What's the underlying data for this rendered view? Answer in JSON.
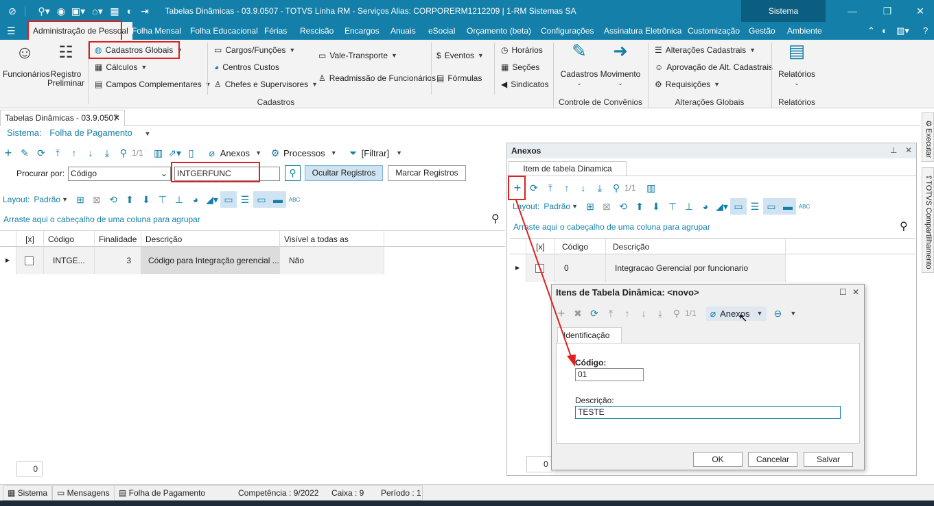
{
  "window": {
    "title": "Tabelas Dinâmicas - 03.9.0507 - TOTVS Linha RM - Serviços  Alias: CORPORERM1212209 | 1-RM Sistemas SA",
    "sistema_tab": "Sistema"
  },
  "menu": [
    "Administração de Pessoal",
    "Folha Mensal",
    "Folha Educacional",
    "Férias",
    "Rescisão",
    "Encargos",
    "Anuais",
    "eSocial",
    "Orçamento (beta)",
    "Configurações",
    "Assinatura Eletrônica",
    "Customização",
    "Gestão",
    "Ambiente"
  ],
  "ribbon": {
    "funcionarios": "Funcionários",
    "registro": "Registro",
    "preliminar": "Preliminar",
    "cadastros_globais": "Cadastros Globais",
    "calculos": "Cálculos",
    "campos_complementares": "Campos Complementares",
    "cargos": "Cargos/Funções",
    "centros": "Centros Custos",
    "chefes": "Chefes e Supervisores",
    "vale": "Vale-Transporte",
    "readmissao": "Readmissão de Funcionários",
    "eventos": "Eventos",
    "formulas": "Fórmulas",
    "horarios": "Horários",
    "secoes": "Seções",
    "sindicatos": "Sindicatos",
    "cadastros_btn": "Cadastros",
    "movimento_btn": "Movimento",
    "alteracoes": "Alterações Cadastrais",
    "aprovacao": "Aprovação de Alt. Cadastrais",
    "requisicoes": "Requisições",
    "relatorios_btn": "Relatórios",
    "grp_cadastros": "Cadastros",
    "grp_convenios": "Controle de Convênios",
    "grp_alteracoes": "Alterações Globais",
    "grp_relatorios": "Relatórios"
  },
  "doc_tab": "Tabelas Dinâmicas - 03.9.0507",
  "sistema": {
    "label": "Sistema:",
    "value": "Folha de Pagamento"
  },
  "toolbar": {
    "page": "1/1",
    "anexos": "Anexos",
    "processos": "Processos",
    "filtrar": "[Filtrar]"
  },
  "search": {
    "label": "Procurar por:",
    "field": "Código",
    "value": "INTGERFUNC",
    "ocultar": "Ocultar Registros",
    "marcar": "Marcar Registros"
  },
  "layout": {
    "label": "Layout:",
    "padrao": "Padrão"
  },
  "group_hint": "Arraste aqui o cabeçalho de uma coluna para agrupar",
  "grid": {
    "headers": [
      "[x]",
      "Código",
      "Finalidade",
      "Descrição",
      "Visível a todas as coligadas"
    ],
    "row": {
      "codigo": "INTGE...",
      "finalidade": "3",
      "descricao": "Código para Integração gerencial ...",
      "visivel": "Não"
    },
    "count": "0"
  },
  "anexos": {
    "title": "Anexos",
    "tab": "Item de tabela Dinamica",
    "page": "1/1",
    "layout": "Layout:",
    "padrao": "Padrão",
    "group_hint": "Arraste aqui o cabeçalho de uma coluna para agrupar",
    "headers": [
      "[x]",
      "Código",
      "Descrição"
    ],
    "row": {
      "codigo": "0",
      "descricao": "Integracao Gerencial por funcionario"
    },
    "count": "0"
  },
  "dialog": {
    "title": "Itens de Tabela Dinâmica: <novo>",
    "page": "1/1",
    "anexos": "Anexos",
    "tab": "Identificação",
    "codigo_label": "Código:",
    "codigo_value": "01",
    "descricao_label": "Descrição:",
    "descricao_value": "TESTE",
    "ok": "OK",
    "cancelar": "Cancelar",
    "salvar": "Salvar"
  },
  "side_tabs": [
    "Executar",
    "TOTVS Compartilhamento"
  ],
  "status": {
    "sistema": "Sistema",
    "mensagens": "Mensagens",
    "folha": "Folha de Pagamento",
    "competencia": "Competência : 9/2022",
    "caixa": "Caixa : 9",
    "periodo": "Período : 1"
  },
  "colors": {
    "accent": "#147fa8",
    "highlight": "#e02020"
  }
}
